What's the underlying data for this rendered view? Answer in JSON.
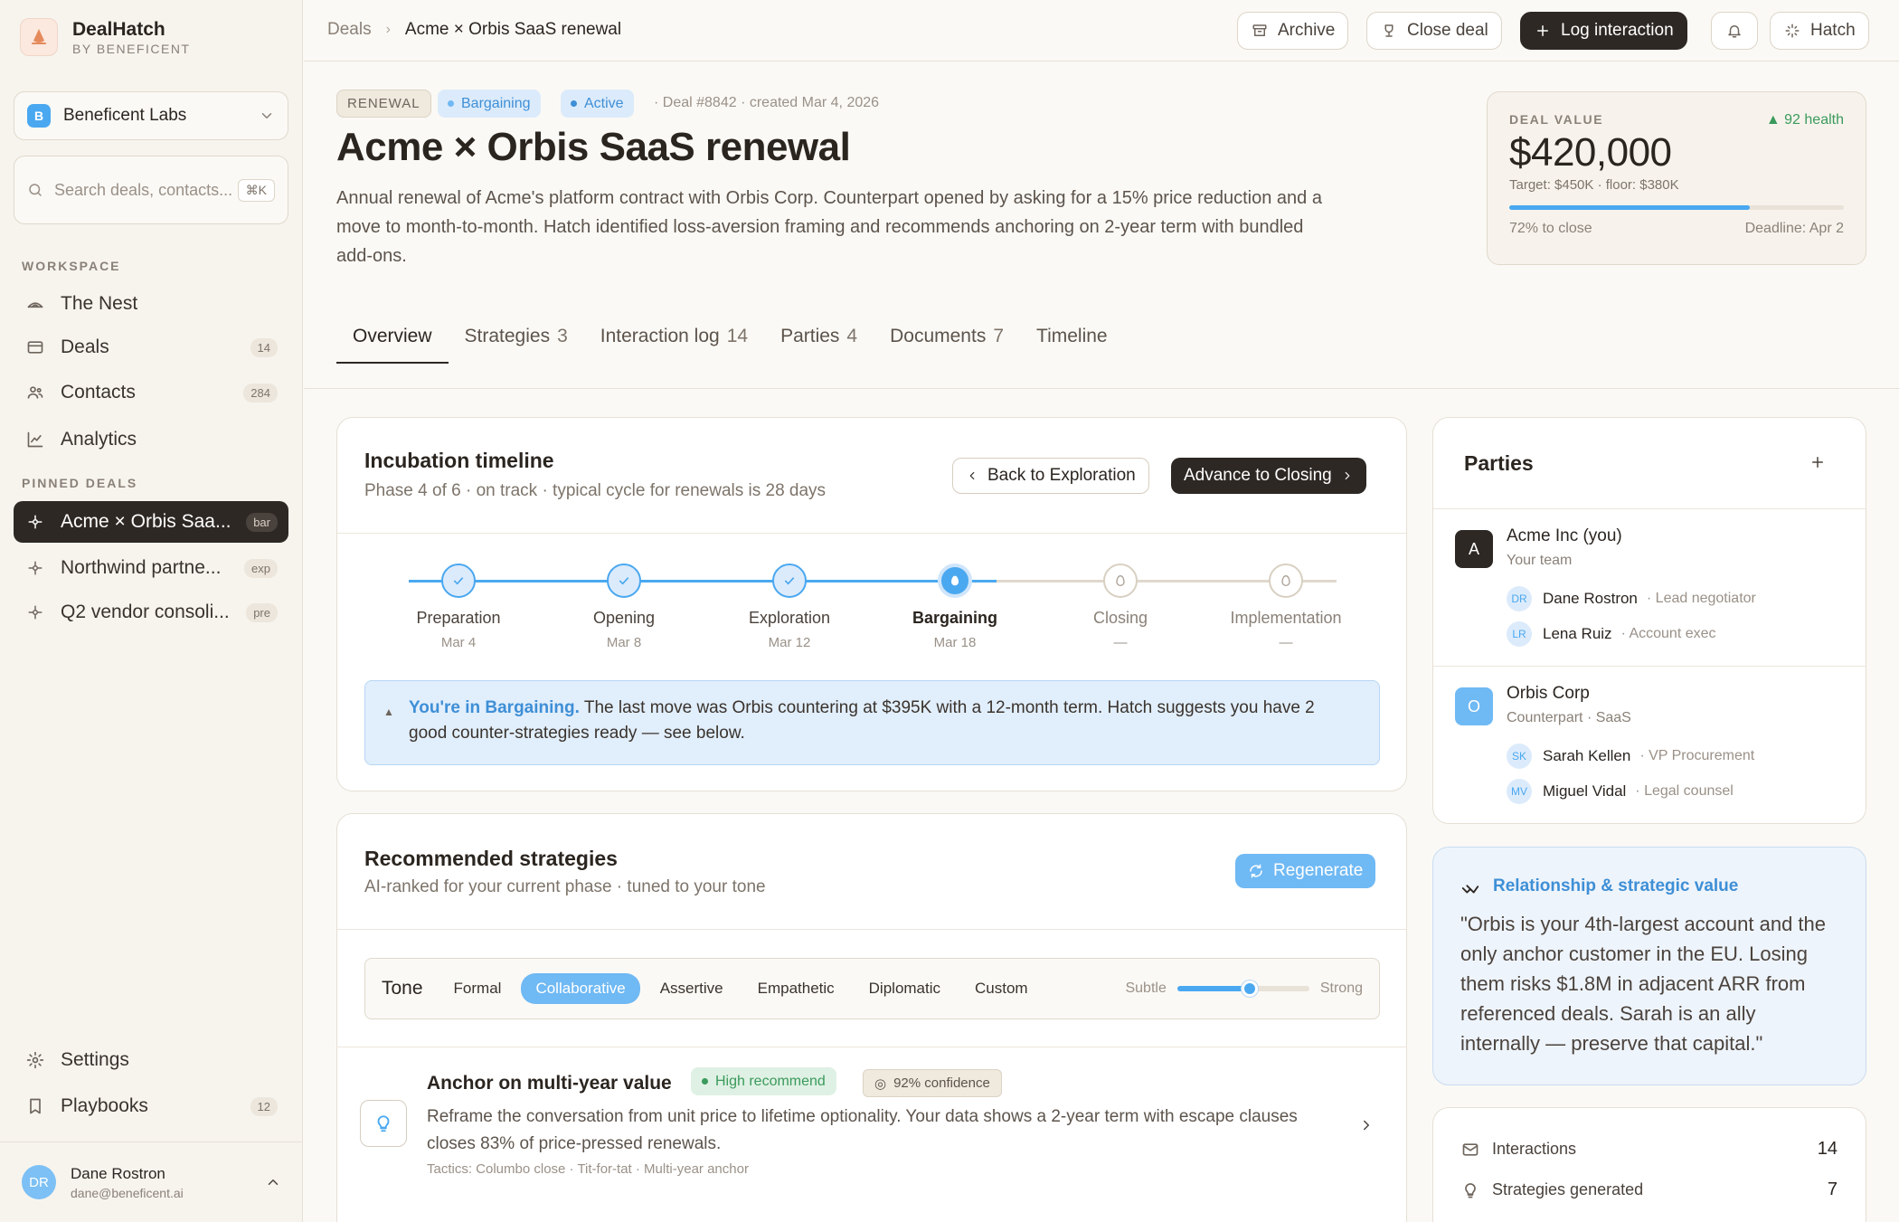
{
  "app": {
    "name": "DealHatch",
    "byline": "BY BENEFICENT"
  },
  "org": {
    "initial": "B",
    "name": "Beneficent Labs"
  },
  "search": {
    "placeholder": "Search deals, contacts...",
    "shortcut": "⌘K"
  },
  "nav": {
    "workspace_label": "WORKSPACE",
    "items": [
      {
        "label": "The Nest",
        "icon": "nest-icon"
      },
      {
        "label": "Deals",
        "icon": "deals-icon",
        "count": "14"
      },
      {
        "label": "Contacts",
        "icon": "contacts-icon",
        "count": "284"
      },
      {
        "label": "Analytics",
        "icon": "analytics-icon"
      }
    ],
    "pinned_label": "PINNED DEALS",
    "pinned": [
      {
        "label": "Acme × Orbis Saa...",
        "badge": "bar"
      },
      {
        "label": "Northwind partne...",
        "badge": "exp"
      },
      {
        "label": "Q2 vendor consoli...",
        "badge": "pre"
      }
    ],
    "settings": "Settings",
    "playbooks": {
      "label": "Playbooks",
      "count": "12"
    }
  },
  "user": {
    "initials": "DR",
    "name": "Dane Rostron",
    "email": "dane@beneficent.ai"
  },
  "breadcrumb": {
    "root": "Deals",
    "current": "Acme × Orbis SaaS renewal"
  },
  "toolbar": {
    "archive": "Archive",
    "close_deal": "Close deal",
    "log_interaction": "Log interaction",
    "hatch": "Hatch"
  },
  "deal": {
    "type_tag": "RENEWAL",
    "phase_tag": "Bargaining",
    "status_tag": "Active",
    "meta": "· Deal #8842 · created Mar 4, 2026",
    "title": "Acme × Orbis SaaS renewal",
    "description": "Annual renewal of Acme's platform contract with Orbis Corp. Counterpart opened by asking for a 15% price reduction and a move to month-to-month. Hatch identified loss-aversion framing and recommends anchoring on 2-year term with bundled add-ons."
  },
  "value_card": {
    "label": "DEAL VALUE",
    "health": "92 health",
    "value": "$420,000",
    "target": "Target: $450K · floor: $380K",
    "progress": 0.72,
    "progress_label": "72% to close",
    "deadline": "Deadline: Apr 2"
  },
  "tabs": [
    {
      "label": "Overview",
      "count": ""
    },
    {
      "label": "Strategies",
      "count": "3"
    },
    {
      "label": "Interaction log",
      "count": "14"
    },
    {
      "label": "Parties",
      "count": "4"
    },
    {
      "label": "Documents",
      "count": "7"
    },
    {
      "label": "Timeline",
      "count": ""
    }
  ],
  "timeline": {
    "title": "Incubation timeline",
    "subtitle": "Phase 4 of 6 · on track · typical cycle for renewals is 28 days",
    "back_button": "Back to Exploration",
    "advance_button": "Advance to Closing",
    "steps": [
      {
        "name": "Preparation",
        "date": "Mar 4",
        "state": "done"
      },
      {
        "name": "Opening",
        "date": "Mar 8",
        "state": "done"
      },
      {
        "name": "Exploration",
        "date": "Mar 12",
        "state": "done"
      },
      {
        "name": "Bargaining",
        "date": "Mar 18",
        "state": "current"
      },
      {
        "name": "Closing",
        "date": "—",
        "state": "future"
      },
      {
        "name": "Implementation",
        "date": "—",
        "state": "future"
      }
    ],
    "callout_highlight": "You're in Bargaining.",
    "callout_text": " The last move was Orbis countering at $395K with a 12-month term. Hatch suggests you have 2 good counter-strategies ready — see below."
  },
  "strategies": {
    "title": "Recommended strategies",
    "subtitle": "AI-ranked for your current phase · tuned to your tone",
    "regenerate": "Regenerate",
    "tone_label": "Tone",
    "tones": [
      "Formal",
      "Collaborative",
      "Assertive",
      "Empathetic",
      "Diplomatic",
      "Custom"
    ],
    "selected_tone": "Collaborative",
    "intensity_min": "Subtle",
    "intensity_max": "Strong",
    "intensity": 0.55,
    "item": {
      "title": "Anchor on multi-year value",
      "recommend": "High recommend",
      "confidence": "92% confidence",
      "description": "Reframe the conversation from unit price to lifetime optionality. Your data shows a 2-year term with escape clauses closes 83% of price-pressed renewals.",
      "tactics": "Tactics: Columbo close · Tit-for-tat · Multi-year anchor"
    }
  },
  "parties": {
    "title": "Parties",
    "groups": [
      {
        "initial": "A",
        "name": "Acme Inc (you)",
        "sub": "Your team",
        "color": "#2e2824",
        "members": [
          {
            "initials": "DR",
            "name": "Dane Rostron",
            "role": "· Lead negotiator"
          },
          {
            "initials": "LR",
            "name": "Lena Ruiz",
            "role": "· Account exec"
          }
        ]
      },
      {
        "initial": "O",
        "name": "Orbis Corp",
        "sub": "Counterpart · SaaS",
        "color": "#6fb9f4",
        "members": [
          {
            "initials": "SK",
            "name": "Sarah Kellen",
            "role": "· VP Procurement"
          },
          {
            "initials": "MV",
            "name": "Miguel Vidal",
            "role": "· Legal counsel"
          }
        ]
      }
    ]
  },
  "relationship": {
    "title": "Relationship & strategic value",
    "quote": "\"Orbis is your 4th-largest account and the only anchor customer in the EU. Losing them risks $1.8M in adjacent ARR from referenced deals. Sarah is an ally internally — preserve that capital.\""
  },
  "stats": [
    {
      "label": "Interactions",
      "value": "14"
    },
    {
      "label": "Strategies generated",
      "value": "7"
    }
  ],
  "colors": {
    "accent": "#4aa8f0",
    "dark": "#2e2824",
    "success": "#3b9a5c"
  }
}
